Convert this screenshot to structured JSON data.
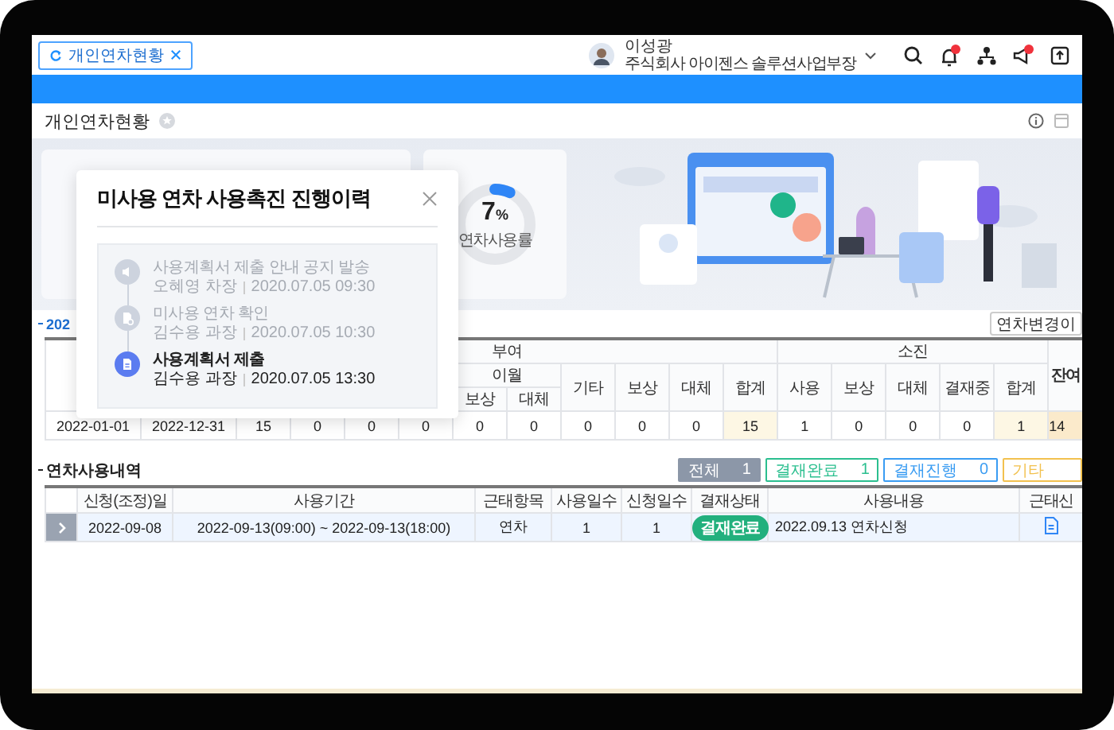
{
  "tab": {
    "label": "개인연차현황",
    "selected": true
  },
  "user": {
    "name": "이성광",
    "org": "주식회사 아이젠스 솔루션사업부장"
  },
  "page_title": "개인연차현황",
  "usage": {
    "value": "7",
    "unit": "%",
    "label": "연차사용률",
    "level": 0.07
  },
  "modal": {
    "title": "미사용 연차 사용촉진 진행이력",
    "steps": [
      {
        "title": "사용계획서 제출 안내 공지 발송",
        "person": "오혜영 차장",
        "time": "2020.07.05 09:30",
        "active": false,
        "kind": "speaker"
      },
      {
        "title": "미사용 연차 확인",
        "person": "김수용 과장",
        "time": "2020.07.05 10:30",
        "active": false,
        "kind": "file"
      },
      {
        "title": "사용계획서 제출",
        "person": "김수용 과장",
        "time": "2020.07.05 13:30",
        "active": true,
        "kind": "document"
      }
    ]
  },
  "summary": {
    "title": "202",
    "button": "연차변경이",
    "grant_group": "부여",
    "carry_group": "이월",
    "carry_cols": [
      "보상",
      "대체"
    ],
    "grant_cols": [
      "기타",
      "보상",
      "대체",
      "합계"
    ],
    "use_group": "소진",
    "use_cols": [
      "사용",
      "보상",
      "대체",
      "결재중",
      "합계"
    ],
    "remain": "잔여",
    "row": [
      "2022-01-01",
      "2022-12-31",
      "15",
      "0",
      "0",
      "0",
      "0",
      "0",
      "0",
      "0",
      "0",
      "15",
      "1",
      "0",
      "0",
      "0",
      "1",
      "14"
    ]
  },
  "history": {
    "title": "연차사용내역",
    "chips": [
      {
        "label": "전체",
        "count": "1",
        "color": "#8c97a8",
        "selected": true
      },
      {
        "label": "결재완료",
        "count": "1",
        "color": "#2bbf8f",
        "selected": false
      },
      {
        "label": "결재진행",
        "count": "0",
        "color": "#3a9cf2",
        "selected": false
      },
      {
        "label": "기타",
        "color": "#f2c14e",
        "selected": false
      }
    ],
    "columns": [
      "신청(조정)일",
      "사용기간",
      "근태항목",
      "사용일수",
      "신청일수",
      "결재상태",
      "사용내용",
      "근태신"
    ],
    "rows": [
      {
        "expanded": false,
        "date": "2022-09-08",
        "period": "2022-09-13(09:00) ~ 2022-09-13(18:00)",
        "type": "연차",
        "used": "1",
        "requested": "1",
        "status": {
          "label": "결재완료",
          "kind": "approved"
        },
        "content": "2022.09.13 연차신청"
      }
    ]
  }
}
